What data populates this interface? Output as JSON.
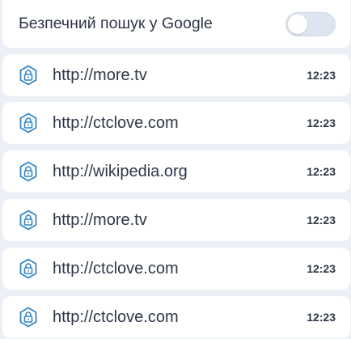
{
  "safe_search": {
    "label": "Безпечний пошук у Google",
    "enabled": false
  },
  "history": [
    {
      "url": "http://more.tv",
      "time": "12:23",
      "icon": "shield-lock-icon"
    },
    {
      "url": "http://ctclove.com",
      "time": "12:23",
      "icon": "shield-lock-icon"
    },
    {
      "url": "http://wikipedia.org",
      "time": "12:23",
      "icon": "shield-lock-icon"
    },
    {
      "url": "http://more.tv",
      "time": "12:23",
      "icon": "shield-lock-icon"
    },
    {
      "url": "http://ctclove.com",
      "time": "12:23",
      "icon": "shield-lock-icon"
    },
    {
      "url": "http://ctclove.com",
      "time": "12:23",
      "icon": "shield-lock-icon"
    }
  ],
  "colors": {
    "background": "#eceff6",
    "card": "#ffffff",
    "icon_accent": "#2f86c9",
    "text": "#2f3648",
    "toggle_track": "#dfe4f1"
  }
}
